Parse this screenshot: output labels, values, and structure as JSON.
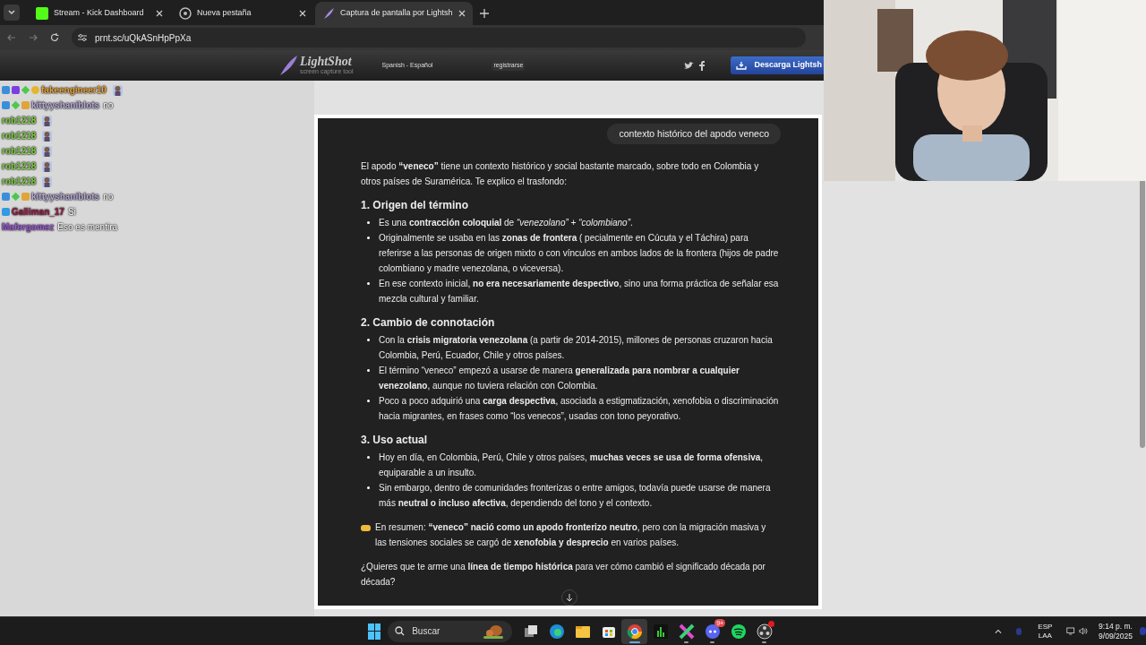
{
  "browser": {
    "tabs": [
      {
        "title": "Stream - Kick Dashboard",
        "kind": "kick",
        "selected": false
      },
      {
        "title": "Nueva pestaña",
        "kind": "chrome",
        "selected": false
      },
      {
        "title": "Captura de pantalla por Lightsh",
        "kind": "lightshot",
        "selected": true
      }
    ],
    "address": "prnt.sc/uQkASnHpPpXa"
  },
  "site_header": {
    "logo": "LightShot",
    "tagline": "screen capture tool",
    "language": "Spanish - Español",
    "register": "registrarse",
    "download": "Descarga Lightsh"
  },
  "chat": [
    {
      "user": "fakeengineer10",
      "color": "#e8a23a",
      "badges": [
        {
          "kind": "verified"
        },
        {
          "kind": "sub"
        },
        {
          "kind": "gift"
        },
        {
          "kind": "coin"
        }
      ],
      "kind": "emote"
    },
    {
      "user": "kittyyshaniblots",
      "color": "#b8a9d8",
      "badges": [
        {
          "kind": "verified"
        },
        {
          "kind": "gift"
        },
        {
          "kind": "crown"
        }
      ],
      "kind": "text",
      "message": "no"
    },
    {
      "user": "rob1218",
      "color": "#86cf4a",
      "kind": "emote"
    },
    {
      "user": "rob1218",
      "color": "#86cf4a",
      "kind": "emote"
    },
    {
      "user": "rob1218",
      "color": "#86cf4a",
      "kind": "emote"
    },
    {
      "user": "rob1218",
      "color": "#86cf4a",
      "kind": "emote"
    },
    {
      "user": "rob1218",
      "color": "#86cf4a",
      "kind": "emote"
    },
    {
      "user": "kittyyshaniblots",
      "color": "#b8a9d8",
      "badges": [
        {
          "kind": "verified"
        },
        {
          "kind": "gift"
        },
        {
          "kind": "crown"
        }
      ],
      "kind": "text",
      "message": "no"
    },
    {
      "user": "Galliman_17",
      "color": "#9a1f4a",
      "badges": [
        {
          "kind": "cube"
        }
      ],
      "kind": "text",
      "message": "Si"
    },
    {
      "user": "Mafergomez",
      "color": "#9b59d6",
      "kind": "text",
      "message": "Eso es mentira"
    }
  ],
  "conversation": {
    "user_message": "contexto histórico del apodo veneco",
    "blocks": [
      {
        "kind": "paragraph",
        "text": "El apodo **“veneco”** tiene un contexto histórico y social bastante marcado, sobre todo en Colombia y otros países de Suramérica. Te explico el trasfondo:"
      },
      {
        "kind": "heading",
        "text": "1. Origen del término"
      },
      {
        "kind": "list",
        "items": [
          "Es una **contracción coloquial** de *“venezolano” + “colombiano”*.",
          "Originalmente se usaba en las **zonas de frontera** (   pecialmente en Cúcuta y el Táchira) para referirse a las personas de origen mixto o con vínculos en ambos lados de la frontera (hijos de padre colombiano y madre venezolana, o viceversa).",
          "En ese contexto inicial, **no era necesariamente despectivo**, sino una forma práctica de señalar esa mezcla cultural y familiar."
        ]
      },
      {
        "kind": "heading",
        "text": "2. Cambio de connotación"
      },
      {
        "kind": "list",
        "items": [
          "Con la **crisis migratoria venezolana** (a partir de 2014-2015), millones de personas cruzaron hacia Colombia, Perú, Ecuador, Chile y otros países.",
          "El término “veneco” empezó a usarse de manera **generalizada para nombrar a cualquier venezolano**, aunque no tuviera relación con Colombia.",
          "Poco a poco adquirió una **carga despectiva**, asociada a estigmatización, xenofobia o discriminación hacia migrantes, en frases como “los venecos”, usadas con tono peyorativo."
        ]
      },
      {
        "kind": "heading",
        "text": "3. Uso actual"
      },
      {
        "kind": "list",
        "items": [
          "Hoy en día, en Colombia, Perú, Chile y otros países, **muchas veces se usa de forma ofensiva**, equiparable a un insulto.",
          "Sin embargo, dentro de comunidades fronterizas o entre amigos, todavía puede usarse de manera más **neutral o incluso afectiva**, dependiendo del tono y el contexto."
        ]
      },
      {
        "kind": "summary",
        "text": "En resumen: **“veneco” nació como un apodo fronterizo neutro**, pero con la migración masiva y las tensiones sociales se cargó de **xenofobia y desprecio** en varios países."
      },
      {
        "kind": "paragraph",
        "text": "¿Quieres que te arme una **línea de tiempo histórica** para ver cómo cambió el significado década por década?"
      }
    ]
  },
  "taskbar": {
    "search_placeholder": "Buscar",
    "apps": [
      {
        "kind": "taskview",
        "selected": false,
        "running": false
      },
      {
        "kind": "edge",
        "selected": false,
        "running": false
      },
      {
        "kind": "files",
        "selected": false,
        "running": false
      },
      {
        "kind": "store",
        "selected": false,
        "running": false
      },
      {
        "kind": "chrome",
        "selected": true,
        "running": false
      },
      {
        "kind": "meter",
        "selected": false,
        "running": false
      },
      {
        "kind": "cross",
        "selected": false,
        "running": true
      },
      {
        "kind": "discord",
        "selected": false,
        "running": true,
        "badge": "9+"
      },
      {
        "kind": "spotify",
        "selected": false,
        "running": false
      },
      {
        "kind": "obs",
        "selected": false,
        "running": true
      }
    ],
    "language": [
      "ESP",
      "LAA"
    ],
    "time": "9:14 p. m.",
    "date": "9/09/2025"
  }
}
